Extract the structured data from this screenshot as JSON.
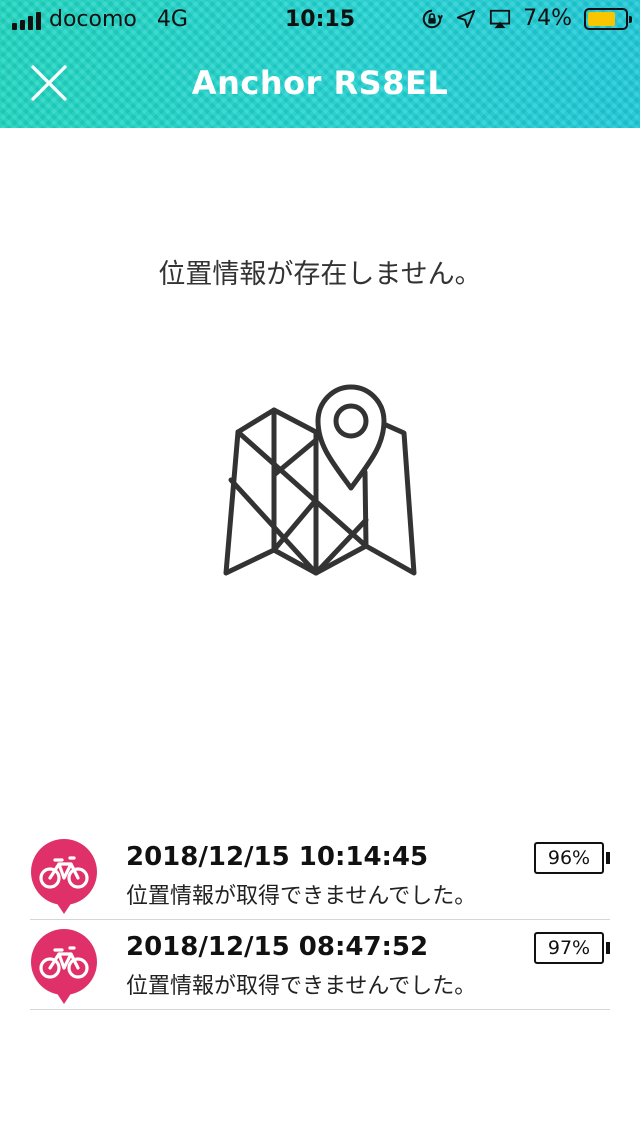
{
  "status_bar": {
    "carrier": "docomo",
    "network": "4G",
    "time": "10:15",
    "battery_percent": "74%",
    "battery_level": 0.74,
    "battery_color": "#f7c600",
    "icons": [
      "signal-icon",
      "orientation-lock-icon",
      "location-arrow-icon",
      "airplay-icon",
      "battery-icon"
    ]
  },
  "header": {
    "title": "Anchor RS8EL",
    "close_icon": "close-icon",
    "accent": "#20d4c8"
  },
  "empty_state": {
    "message": "位置情報が存在しません。",
    "icon": "map-pin-icon"
  },
  "history": [
    {
      "datetime": "2018/12/15 10:14:45",
      "message": "位置情報が取得できませんでした。",
      "battery": "96%",
      "icon": "bicycle-pin-icon"
    },
    {
      "datetime": "2018/12/15 08:47:52",
      "message": "位置情報が取得できませんでした。",
      "battery": "97%",
      "icon": "bicycle-pin-icon"
    }
  ],
  "colors": {
    "pin": "#e0306a",
    "divider": "#d6d6d6"
  }
}
